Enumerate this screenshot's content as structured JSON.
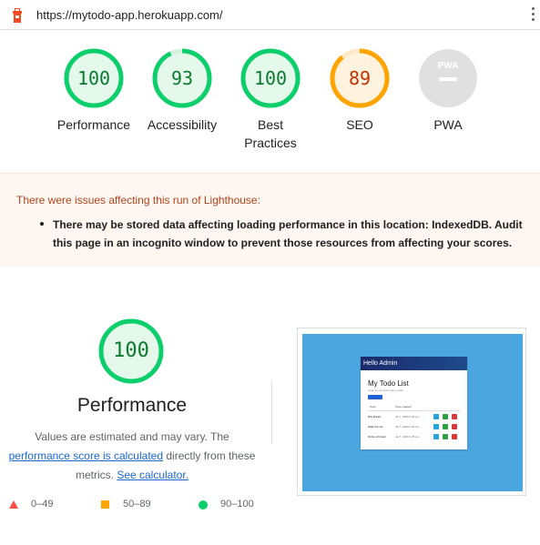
{
  "browser": {
    "url": "https://mytodo-app.herokuapp.com/",
    "icon": "lighthouse-icon",
    "menu_icon": "kebab-menu-icon"
  },
  "scores": [
    {
      "label": "Performance",
      "value": "100",
      "score": 100,
      "color": "#0cce6b",
      "text_color": "#0b7a2f"
    },
    {
      "label": "Accessibility",
      "value": "93",
      "score": 93,
      "color": "#0cce6b",
      "text_color": "#0b7a2f"
    },
    {
      "label": "Best Practices",
      "value": "100",
      "score": 100,
      "color": "#0cce6b",
      "text_color": "#0b7a2f"
    },
    {
      "label": "SEO",
      "value": "89",
      "score": 89,
      "color": "#ffa400",
      "text_color": "#c33300"
    },
    {
      "label": "PWA",
      "value": "PWA",
      "color": "#e0e0e0"
    }
  ],
  "warning": {
    "title": "There were issues affecting this run of Lighthouse:",
    "item": "There may be stored data affecting loading performance in this location: IndexedDB. Audit this page in an incognito window to prevent those resources from affecting your scores."
  },
  "performance": {
    "score": "100",
    "title": "Performance",
    "desc_1": "Values are estimated and may vary. The",
    "link_1": "performance score is calculated",
    "desc_2": "directly from these metrics.",
    "link_2": "See calculator."
  },
  "legend": [
    {
      "range": "0–49",
      "color": "#ff4e42",
      "icon": "triangle-icon"
    },
    {
      "range": "50–89",
      "color": "#ffa400",
      "icon": "square-icon"
    },
    {
      "range": "90–100",
      "color": "#0cce6b",
      "icon": "circle-icon"
    }
  ],
  "screenshot": {
    "header": "Hello Admin",
    "title": "My Todo List",
    "subtitle": "what do you want done today",
    "button": "Add Todo",
    "col_1": "Todo",
    "col_2": "Time created",
    "rows": [
      {
        "todo": "Buy Bread",
        "time": "Jul 7, 2020 1:23 pm"
      },
      {
        "todo": "Walk the cat",
        "time": "Jul 7, 2020 1:24 pm"
      },
      {
        "todo": "Drink a Protein",
        "time": "Jul 7, 2020 1:25 pm"
      }
    ]
  }
}
